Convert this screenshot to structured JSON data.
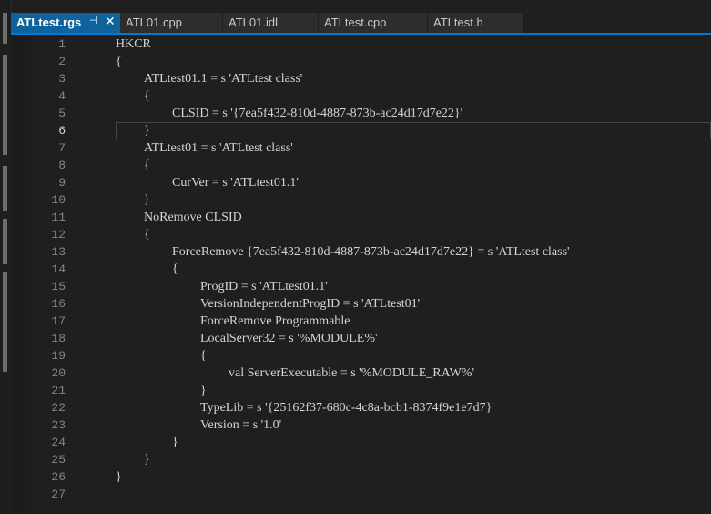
{
  "tabs": [
    {
      "label": "ATLtest.rgs",
      "active": true,
      "pin_glyph": "⊣",
      "close_glyph": "✕"
    },
    {
      "label": "ATL01.cpp",
      "active": false
    },
    {
      "label": "ATL01.idl",
      "active": false
    },
    {
      "label": "ATLtest.cpp",
      "active": false
    },
    {
      "label": "ATLtest.h",
      "active": false
    }
  ],
  "editor": {
    "current_line": 6,
    "lines": [
      {
        "n": "1",
        "indent": 0,
        "text": "HKCR"
      },
      {
        "n": "2",
        "indent": 0,
        "text": "{"
      },
      {
        "n": "3",
        "indent": 1,
        "text": "ATLtest01.1 = s 'ATLtest class'"
      },
      {
        "n": "4",
        "indent": 1,
        "text": "{"
      },
      {
        "n": "5",
        "indent": 2,
        "text": "CLSID = s '{7ea5f432-810d-4887-873b-ac24d17d7e22}'"
      },
      {
        "n": "6",
        "indent": 1,
        "text": "}"
      },
      {
        "n": "7",
        "indent": 1,
        "text": "ATLtest01 = s 'ATLtest class'"
      },
      {
        "n": "8",
        "indent": 1,
        "text": "{"
      },
      {
        "n": "9",
        "indent": 2,
        "text": "CurVer = s 'ATLtest01.1'"
      },
      {
        "n": "10",
        "indent": 1,
        "text": "}"
      },
      {
        "n": "11",
        "indent": 1,
        "text": "NoRemove CLSID"
      },
      {
        "n": "12",
        "indent": 1,
        "text": "{"
      },
      {
        "n": "13",
        "indent": 2,
        "text": "ForceRemove {7ea5f432-810d-4887-873b-ac24d17d7e22} = s 'ATLtest class'"
      },
      {
        "n": "14",
        "indent": 2,
        "text": "{"
      },
      {
        "n": "15",
        "indent": 3,
        "text": "ProgID = s 'ATLtest01.1'"
      },
      {
        "n": "16",
        "indent": 3,
        "text": "VersionIndependentProgID = s 'ATLtest01'"
      },
      {
        "n": "17",
        "indent": 3,
        "text": "ForceRemove Programmable"
      },
      {
        "n": "18",
        "indent": 3,
        "text": "LocalServer32 = s '%MODULE%'"
      },
      {
        "n": "19",
        "indent": 3,
        "text": "{"
      },
      {
        "n": "20",
        "indent": 4,
        "text": "val ServerExecutable = s '%MODULE_RAW%'"
      },
      {
        "n": "21",
        "indent": 3,
        "text": "}"
      },
      {
        "n": "22",
        "indent": 3,
        "text": "TypeLib = s '{25162f37-680c-4c8a-bcb1-8374f9e1e7d7}'"
      },
      {
        "n": "23",
        "indent": 3,
        "text": "Version = s '1.0'"
      },
      {
        "n": "24",
        "indent": 2,
        "text": "}"
      },
      {
        "n": "25",
        "indent": 1,
        "text": "}"
      },
      {
        "n": "26",
        "indent": 0,
        "text": "}"
      },
      {
        "n": "27",
        "indent": 0,
        "text": ""
      }
    ]
  }
}
